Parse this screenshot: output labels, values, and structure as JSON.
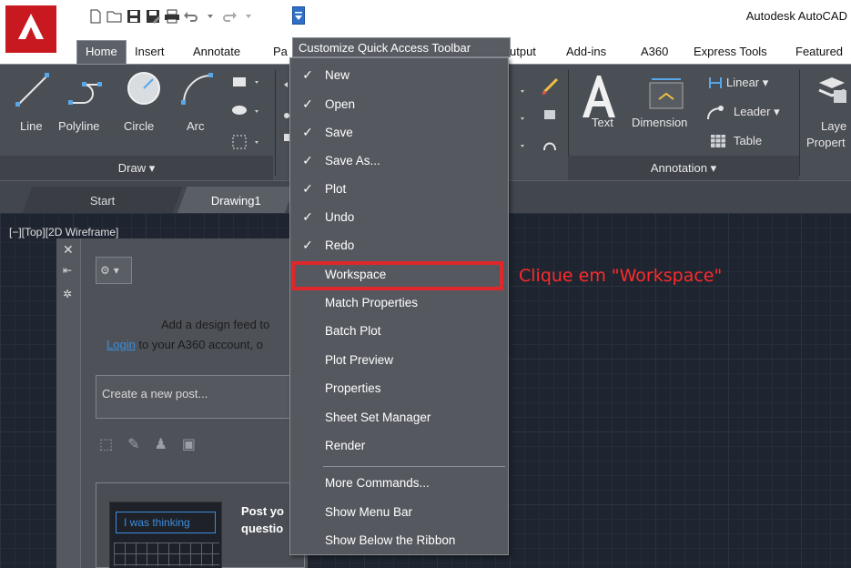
{
  "window": {
    "title": "Autodesk AutoCAD"
  },
  "quick_access": {
    "icons": [
      "new-icon",
      "open-icon",
      "save-icon",
      "save-as-icon",
      "plot-icon",
      "undo-icon",
      "redo-icon",
      "qat-dropdown-icon"
    ]
  },
  "ribbon_tabs": [
    "Home",
    "Insert",
    "Annotate",
    "Pa",
    "utput",
    "Add-ins",
    "A360",
    "Express Tools",
    "Featured"
  ],
  "ribbon": {
    "draw": {
      "line": "Line",
      "polyline": "Polyline",
      "circle": "Circle",
      "arc": "Arc",
      "panel_title": "Draw ▾"
    },
    "annotation": {
      "text": "Text",
      "dimension": "Dimension",
      "linear": "Linear ▾",
      "leader": "Leader ▾",
      "table": "Table",
      "panel_title": "Annotation ▾"
    },
    "layers": {
      "label_1": "Laye",
      "label_2": "Propert"
    }
  },
  "doc_tabs": {
    "start": "Start",
    "drawing1": "Drawing1"
  },
  "viewport": {
    "label": "[−][Top][2D Wireframe]"
  },
  "design_feed": {
    "line1": "Add a design feed to",
    "login": "Login",
    "line2_rest": " to your A360 account, o",
    "new_post_placeholder": "Create a new post...",
    "thinking": "I was thinking",
    "post_line1": "Post yo",
    "post_line2": "questio"
  },
  "menu": {
    "header": "Customize Quick Access Toolbar",
    "items": [
      {
        "label": "New",
        "checked": true
      },
      {
        "label": "Open",
        "checked": true
      },
      {
        "label": "Save",
        "checked": true
      },
      {
        "label": "Save As...",
        "checked": true
      },
      {
        "label": "Plot",
        "checked": true
      },
      {
        "label": "Undo",
        "checked": true
      },
      {
        "label": "Redo",
        "checked": true
      },
      {
        "label": "Workspace",
        "checked": false
      },
      {
        "label": "Match Properties",
        "checked": false
      },
      {
        "label": "Batch Plot",
        "checked": false
      },
      {
        "label": "Plot Preview",
        "checked": false
      },
      {
        "label": "Properties",
        "checked": false
      },
      {
        "label": "Sheet Set Manager",
        "checked": false
      },
      {
        "label": "Render",
        "checked": false
      },
      {
        "label": "More Commands...",
        "checked": false
      },
      {
        "label": "Show Menu Bar",
        "checked": false
      },
      {
        "label": "Show Below the Ribbon",
        "checked": false
      }
    ],
    "check_glyph": "✓"
  },
  "annotation_callout": "Clique em \"Workspace\"",
  "colors": {
    "highlight": "#e0272b",
    "callout": "#ff2a2a",
    "menu_bg": "#55595f",
    "canvas_bg": "#1f2530"
  }
}
